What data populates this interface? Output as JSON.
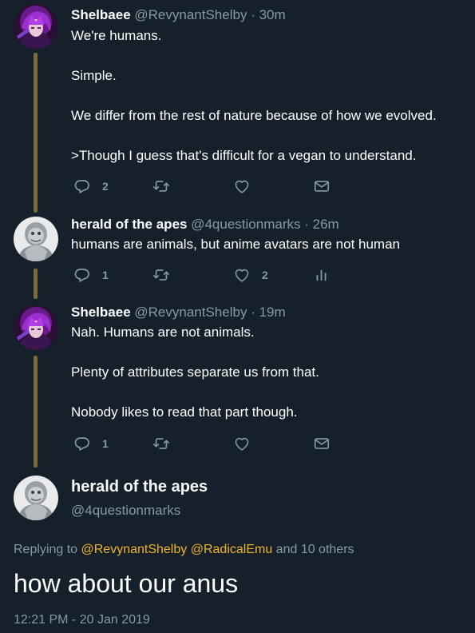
{
  "tweets": [
    {
      "display_name": "Shelbaee",
      "handle": "@RevynantShelby",
      "dot": "·",
      "time": "30m",
      "paragraphs": [
        "We're humans.",
        "Simple.",
        "We differ from the rest of nature because of how we evolved.",
        ">Though I guess that's difficult for a vegan to understand."
      ],
      "reply_count": "2"
    },
    {
      "display_name": "herald of the apes",
      "handle": "@4questionmarks",
      "dot": "·",
      "time": "26m",
      "paragraphs": [
        "humans are animals, but anime avatars are not human"
      ],
      "reply_count": "1",
      "like_count": "2"
    },
    {
      "display_name": "Shelbaee",
      "handle": "@RevynantShelby",
      "dot": "·",
      "time": "19m",
      "paragraphs": [
        "Nah. Humans are not animals.",
        "Plenty of attributes separate us from that.",
        "Nobody likes to read that part though."
      ],
      "reply_count": "1"
    }
  ],
  "main_tweet": {
    "display_name": "herald of the apes",
    "handle": "@4questionmarks",
    "replying_prefix": "Replying to",
    "mention_1": "@RevynantShelby",
    "mention_2": "@RadicalEmu",
    "replying_suffix": "and 10 others",
    "text": "how about our anus",
    "timestamp": "12:21 PM - 20 Jan 2019"
  },
  "icons": {
    "reply": "reply-icon",
    "retweet": "retweet-icon",
    "like": "heart-icon",
    "dm": "envelope-icon",
    "analytics": "analytics-icon"
  },
  "colors": {
    "background": "#15202b",
    "thread_line": "#7a6a33",
    "secondary_text": "#8899a6",
    "mention": "#f0b429"
  }
}
